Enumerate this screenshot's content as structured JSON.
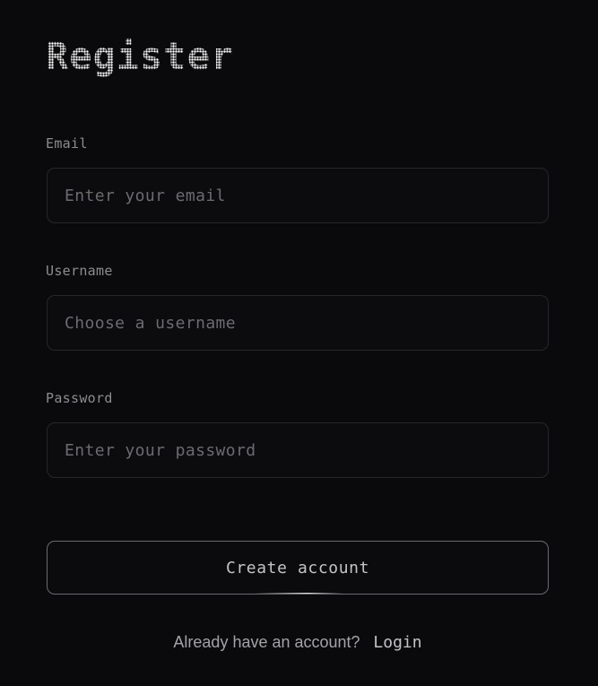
{
  "form": {
    "title": "Register",
    "email": {
      "label": "Email",
      "placeholder": "Enter your email",
      "value": ""
    },
    "username": {
      "label": "Username",
      "placeholder": "Choose a username",
      "value": ""
    },
    "password": {
      "label": "Password",
      "placeholder": "Enter your password",
      "value": ""
    },
    "submit_label": "Create account"
  },
  "footer": {
    "prompt": "Already have an account?",
    "login_link": "Login"
  },
  "colors": {
    "background": "#0a0a0c",
    "input_border": "#26262b",
    "button_border": "#6a6a70",
    "label_text": "#8c8c90",
    "placeholder_text": "#6b6b70"
  }
}
